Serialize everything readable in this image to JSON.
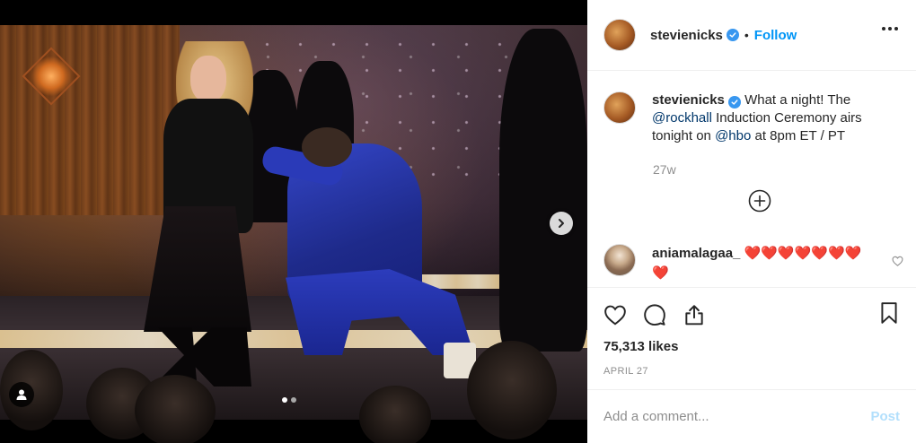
{
  "post": {
    "username": "stevienicks",
    "follow_label": "Follow",
    "bullet": "•",
    "caption": {
      "before_mention1": "What a night! The ",
      "mention1": "@rockhall",
      "between": " Induction Ceremony airs tonight on ",
      "mention2": "@hbo",
      "after": " at 8pm ET / PT"
    },
    "time_ago": "27w",
    "likes": "75,313 likes",
    "date": "APRIL 27"
  },
  "comment": {
    "username": "aniamalagaa_",
    "text": "❤️❤️❤️❤️❤️❤️❤️❤️"
  },
  "composer": {
    "placeholder": "Add a comment...",
    "post_label": "Post"
  },
  "carousel": {
    "slide_count": 2,
    "active_index": 0
  },
  "icons": {
    "verified": "verified-badge-icon",
    "more": "more-options-icon",
    "add": "plus-circle-icon",
    "like": "heart-icon",
    "comment": "comment-bubble-icon",
    "share": "share-icon",
    "save": "bookmark-icon",
    "next": "chevron-right-icon",
    "tag": "user-tag-icon"
  },
  "colors": {
    "follow": "#0095f6",
    "verified": "#3897f0",
    "mention": "#00376b",
    "muted": "#8e8e8e",
    "post_disabled": "#b2dffc"
  }
}
